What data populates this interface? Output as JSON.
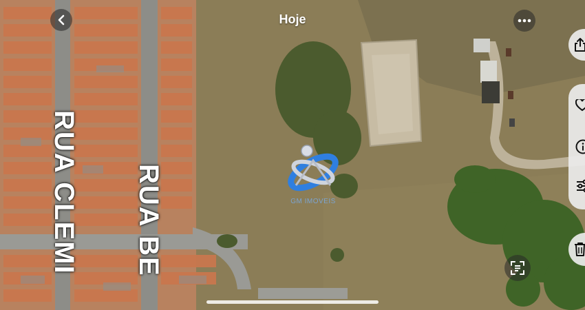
{
  "header": {
    "title": "Hoje"
  },
  "map": {
    "street_labels": [
      "RUA CLEMI",
      "RUA BE"
    ]
  },
  "watermark": {
    "brand_text": "GM IMOVEIS",
    "accent": "#2f7fe0"
  },
  "icons": {
    "back": "chevron-left-icon",
    "more": "ellipsis-icon",
    "share": "share-icon",
    "favorite": "heart-icon",
    "info": "info-icon",
    "adjust": "sliders-icon",
    "delete": "trash-icon",
    "live_text": "text-scan-icon"
  },
  "colors": {
    "roof": "#c9774e",
    "field": "#8a7c55",
    "grass": "#4f6a2f",
    "road": "#9a9a95"
  }
}
